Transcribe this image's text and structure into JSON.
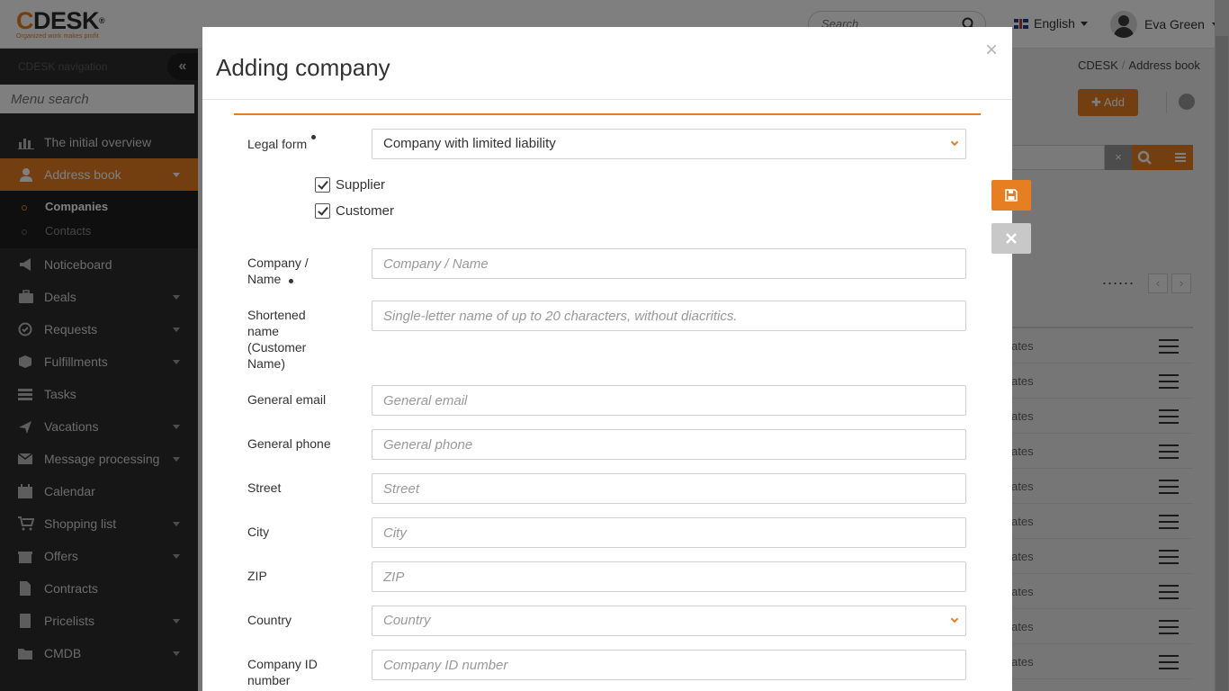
{
  "header": {
    "logo_c": "C",
    "logo_rest": "DESK",
    "logo_reg": "®",
    "logo_tagline": "Organized work makes profit",
    "search_placeholder": "Search",
    "language": "English",
    "user_name": "Eva Green"
  },
  "sidebar": {
    "nav_title": "CDESK navigation",
    "menu_search_placeholder": "Menu search",
    "items": [
      {
        "label": "The initial overview",
        "icon": "chart-icon",
        "arrow": false
      },
      {
        "label": "Address book",
        "icon": "user-icon",
        "arrow": true,
        "active": true
      },
      {
        "label": "Noticeboard",
        "icon": "megaphone-icon",
        "arrow": false
      },
      {
        "label": "Deals",
        "icon": "briefcase-icon",
        "arrow": true
      },
      {
        "label": "Requests",
        "icon": "check-circle-icon",
        "arrow": true
      },
      {
        "label": "Fulfillments",
        "icon": "cube-icon",
        "arrow": true
      },
      {
        "label": "Tasks",
        "icon": "tasks-icon",
        "arrow": false
      },
      {
        "label": "Vacations",
        "icon": "plane-icon",
        "arrow": true
      },
      {
        "label": "Message processing",
        "icon": "envelope-icon",
        "arrow": true
      },
      {
        "label": "Calendar",
        "icon": "calendar-icon",
        "arrow": false
      },
      {
        "label": "Shopping list",
        "icon": "cart-icon",
        "arrow": true
      },
      {
        "label": "Offers",
        "icon": "gift-icon",
        "arrow": true
      },
      {
        "label": "Contracts",
        "icon": "document-icon",
        "arrow": false
      },
      {
        "label": "Pricelists",
        "icon": "book-icon",
        "arrow": true
      },
      {
        "label": "CMDB",
        "icon": "folder-icon",
        "arrow": true
      }
    ],
    "submenu": [
      {
        "label": "Companies",
        "active": true
      },
      {
        "label": "Contacts",
        "active": false
      }
    ]
  },
  "background": {
    "breadcrumb_home": "CDESK",
    "breadcrumb_sep": "/",
    "breadcrumb_current": "Address book",
    "add_button": "Add",
    "clear_symbol": "×",
    "pager_dots": "......",
    "prev_symbol": "‹",
    "next_symbol": "›",
    "row_text": "ates"
  },
  "modal": {
    "title": "Adding company",
    "close_symbol": "×",
    "legal_form_label": "Legal form",
    "legal_form_value": "Company with limited liability",
    "supplier_label": "Supplier",
    "customer_label": "Customer",
    "company_name_label_1": "Company /",
    "company_name_label_2": "Name",
    "company_name_placeholder": "Company / Name",
    "short_name_label_1": "Shortened",
    "short_name_label_2": "name",
    "short_name_label_3": "(Customer",
    "short_name_label_4": "Name)",
    "short_name_placeholder": "Single-letter name of up to 20 characters, without diacritics.",
    "email_label": "General email",
    "email_placeholder": "General email",
    "phone_label": "General phone",
    "phone_placeholder": "General phone",
    "street_label": "Street",
    "street_placeholder": "Street",
    "city_label": "City",
    "city_placeholder": "City",
    "zip_label": "ZIP",
    "zip_placeholder": "ZIP",
    "country_label": "Country",
    "country_placeholder": "Country",
    "company_id_label_1": "Company ID",
    "company_id_label_2": "number",
    "company_id_placeholder": "Company ID number"
  },
  "colors": {
    "accent": "#e67e22",
    "sidebar_bg": "#2d2d2d",
    "overlay": "rgba(0,0,0,0.5)"
  }
}
